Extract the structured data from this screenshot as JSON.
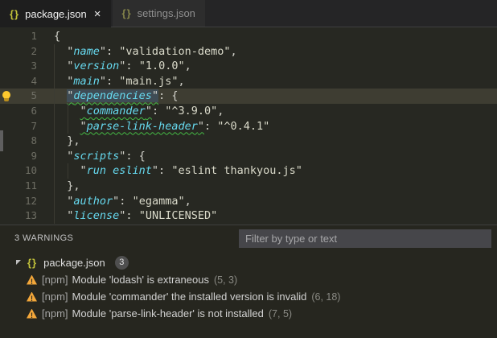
{
  "icons": {
    "braces": "{}",
    "close": "×"
  },
  "tabs": [
    {
      "label": "package.json",
      "active": true
    },
    {
      "label": "settings.json",
      "active": false
    }
  ],
  "editor": {
    "lines": [
      {
        "num": "1",
        "tokens": [
          [
            "p",
            "{"
          ]
        ]
      },
      {
        "num": "2",
        "tokens": [
          [
            "p",
            "  \""
          ],
          [
            "k",
            "name"
          ],
          [
            "p",
            "\": "
          ],
          [
            "s",
            "\"validation-demo\""
          ],
          [
            "p",
            ","
          ]
        ]
      },
      {
        "num": "3",
        "tokens": [
          [
            "p",
            "  \""
          ],
          [
            "k",
            "version"
          ],
          [
            "p",
            "\": "
          ],
          [
            "s",
            "\"1.0.0\""
          ],
          [
            "p",
            ","
          ]
        ]
      },
      {
        "num": "4",
        "tokens": [
          [
            "p",
            "  \""
          ],
          [
            "k",
            "main"
          ],
          [
            "p",
            "\": "
          ],
          [
            "s",
            "\"main.js\""
          ],
          [
            "p",
            ","
          ]
        ]
      },
      {
        "num": "5",
        "current": true,
        "lightbulb": true,
        "tokens": [
          [
            "p",
            "  "
          ],
          [
            "pws",
            "\""
          ],
          [
            "kws",
            "dependencies"
          ],
          [
            "pws",
            "\""
          ],
          [
            "p",
            ": {"
          ]
        ]
      },
      {
        "num": "6",
        "tokens": [
          [
            "p",
            "    "
          ],
          [
            "pw",
            "\""
          ],
          [
            "kw",
            "commander"
          ],
          [
            "pw",
            "\""
          ],
          [
            "p",
            ": "
          ],
          [
            "s",
            "\"^3.9.0\""
          ],
          [
            "p",
            ","
          ]
        ]
      },
      {
        "num": "7",
        "tokens": [
          [
            "p",
            "    "
          ],
          [
            "pw",
            "\""
          ],
          [
            "kw",
            "parse-link-header"
          ],
          [
            "pw",
            "\""
          ],
          [
            "p",
            ": "
          ],
          [
            "s",
            "\"^0.4.1\""
          ]
        ]
      },
      {
        "num": "8",
        "tokens": [
          [
            "p",
            "  },"
          ]
        ]
      },
      {
        "num": "9",
        "tokens": [
          [
            "p",
            "  \""
          ],
          [
            "k",
            "scripts"
          ],
          [
            "p",
            "\": {"
          ]
        ]
      },
      {
        "num": "10",
        "tokens": [
          [
            "p",
            "    \""
          ],
          [
            "k",
            "run eslint"
          ],
          [
            "p",
            "\": "
          ],
          [
            "s",
            "\"eslint thankyou.js\""
          ]
        ]
      },
      {
        "num": "11",
        "tokens": [
          [
            "p",
            "  },"
          ]
        ]
      },
      {
        "num": "12",
        "tokens": [
          [
            "p",
            "  \""
          ],
          [
            "k",
            "author"
          ],
          [
            "p",
            "\": "
          ],
          [
            "s",
            "\"egamma\""
          ],
          [
            "p",
            ","
          ]
        ]
      },
      {
        "num": "13",
        "tokens": [
          [
            "p",
            "  \""
          ],
          [
            "k",
            "license"
          ],
          [
            "p",
            "\": "
          ],
          [
            "s",
            "\"UNLICENSED\""
          ]
        ]
      }
    ]
  },
  "problems": {
    "summary": "3 WARNINGS",
    "filter_placeholder": "Filter by type or text",
    "group": {
      "file": "package.json",
      "count": "3"
    },
    "items": [
      {
        "severity": "warning",
        "source": "[npm]",
        "message": "Module 'lodash' is extraneous",
        "location": "(5, 3)"
      },
      {
        "severity": "warning",
        "source": "[npm]",
        "message": "Module 'commander' the installed version is invalid",
        "location": "(6, 18)"
      },
      {
        "severity": "warning",
        "source": "[npm]",
        "message": "Module 'parse-link-header' is not installed",
        "location": "(7, 5)"
      }
    ]
  },
  "colors": {
    "editor_bg": "#272822",
    "chrome_bg": "#252526",
    "current_line": "#3e3d32",
    "key": "#66d9ef",
    "string": "#dadaca",
    "squiggle": "#44b944",
    "warning_icon": "#f3a73a",
    "braces_icon": "#c3c33a",
    "badge_bg": "#4f4f4f"
  }
}
